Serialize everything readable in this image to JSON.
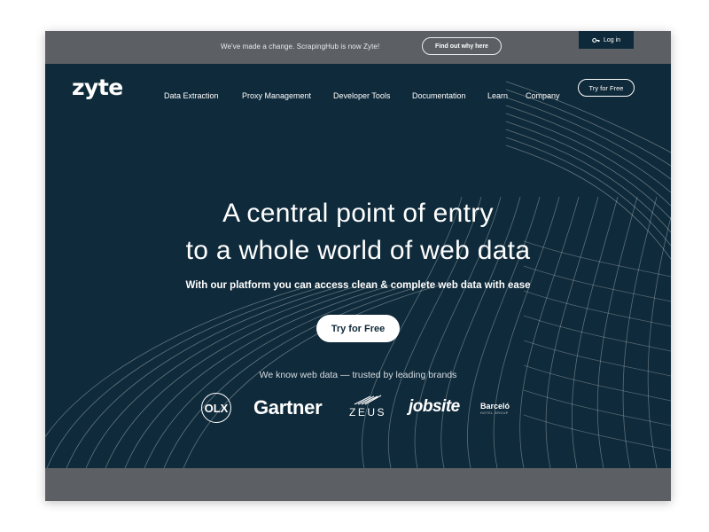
{
  "announcement": {
    "text": "We've made a change. ScrapingHub is now Zyte!",
    "button_label": "Find out why here"
  },
  "login": {
    "label": "Log in",
    "icon": "key-icon"
  },
  "header": {
    "logo": "zyte",
    "nav": [
      "Data Extraction",
      "Proxy Management",
      "Developer Tools",
      "Documentation",
      "Learn",
      "Company"
    ],
    "cta_label": "Try for Free"
  },
  "hero": {
    "headline_line1": "A central point of entry",
    "headline_line2": "to a whole world of web data",
    "subheadline": "With our platform you can access clean & complete web data with ease",
    "cta_label": "Try for Free",
    "trusted_text": "We know web data — trusted by leading brands"
  },
  "brands": {
    "olx": "OLX",
    "gartner": "Gartner",
    "zeus": "ZEUS",
    "jobsite": "jobsite",
    "barcelo": "Barceló",
    "barcelo_sub": "HOTEL GROUP"
  },
  "colors": {
    "navy": "#0f2a3a",
    "gray_bar": "#5c6065",
    "white": "#ffffff"
  }
}
